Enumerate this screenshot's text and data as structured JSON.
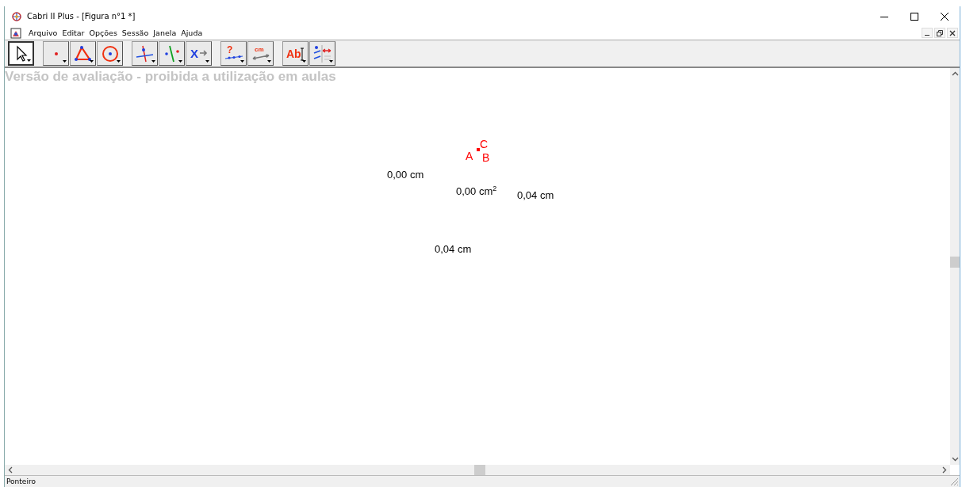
{
  "window": {
    "title": "Cabri II Plus - [Figura n°1 *]"
  },
  "menu": [
    "Arquivo",
    "Editar",
    "Opções",
    "Sessão",
    "Janela",
    "Ajuda"
  ],
  "toolbar": [
    {
      "kind": "pointer",
      "selected": true
    },
    {
      "kind": "point",
      "selected": false
    },
    {
      "kind": "triangle",
      "selected": false
    },
    {
      "kind": "circle",
      "selected": false
    },
    {
      "kind": "perpendicular",
      "selected": false
    },
    {
      "kind": "parallel",
      "selected": false
    },
    {
      "kind": "transform",
      "label": "X",
      "selected": false
    },
    {
      "kind": "check",
      "label": "?",
      "selected": false
    },
    {
      "kind": "measure",
      "label": "cm",
      "selected": false
    },
    {
      "kind": "text",
      "label": "Ab",
      "selected": false
    },
    {
      "kind": "attributes",
      "selected": false
    }
  ],
  "canvas": {
    "notice": "Versão de avaliação - proibida a utilização em aulas",
    "items": [
      {
        "kind": "label",
        "text": "C",
        "color": "#ff0000"
      },
      {
        "kind": "label",
        "text": "A",
        "color": "#ff0000"
      },
      {
        "kind": "label",
        "text": "B",
        "color": "#ff0000"
      },
      {
        "kind": "point",
        "color": "#ff0000"
      },
      {
        "kind": "measure",
        "text": "0,00 cm"
      },
      {
        "kind": "measure",
        "text": "0,00 cm$^{2}$"
      },
      {
        "kind": "measure",
        "text": "0,04 cm"
      },
      {
        "kind": "measure",
        "text": "0,04 cm"
      }
    ]
  },
  "status_bar": {
    "text": "Ponteiro"
  }
}
